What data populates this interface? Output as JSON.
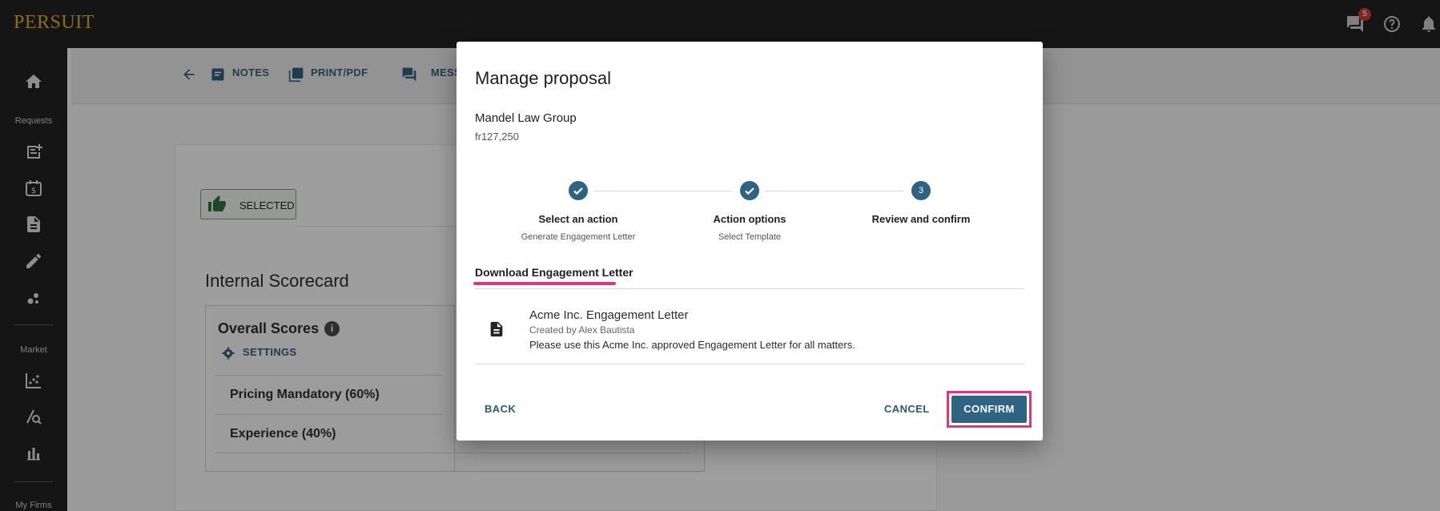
{
  "app": {
    "logo": "PERSUIT",
    "notification_count": "5"
  },
  "sidebar": {
    "section_requests": "Requests",
    "section_market": "Market",
    "section_firms": "My Firms"
  },
  "toolbar": {
    "notes": "NOTES",
    "print": "PRINT/PDF",
    "messages": "MESS"
  },
  "background": {
    "selected_chip": "SELECTED",
    "scorecard_title": "Internal Scorecard",
    "overall_scores": "Overall Scores",
    "info_glyph": "i",
    "settings": "SETTINGS",
    "rows": [
      "Pricing Mandatory (60%)",
      "Experience (40%)"
    ]
  },
  "modal": {
    "title": "Manage proposal",
    "firm": "Mandel Law Group",
    "amount": "fr127,250",
    "steps": [
      {
        "title": "Select an action",
        "subtitle": "Generate Engagement Letter",
        "state": "done"
      },
      {
        "title": "Action options",
        "subtitle": "Select Template",
        "state": "done"
      },
      {
        "title": "Review and confirm",
        "subtitle": "",
        "number": "3",
        "state": "active"
      }
    ],
    "tab": "Download Engagement Letter",
    "document": {
      "title": "Acme Inc. Engagement Letter",
      "created_by": "Created by Alex Bautista",
      "description": "Please use this Acme Inc. approved Engagement Letter for all matters."
    },
    "buttons": {
      "back": "BACK",
      "cancel": "CANCEL",
      "confirm": "CONFIRM"
    }
  },
  "colors": {
    "accent": "#2e6381",
    "highlight": "#e0357e",
    "logo": "#c9a227",
    "topbar": "#1f1f1f"
  }
}
